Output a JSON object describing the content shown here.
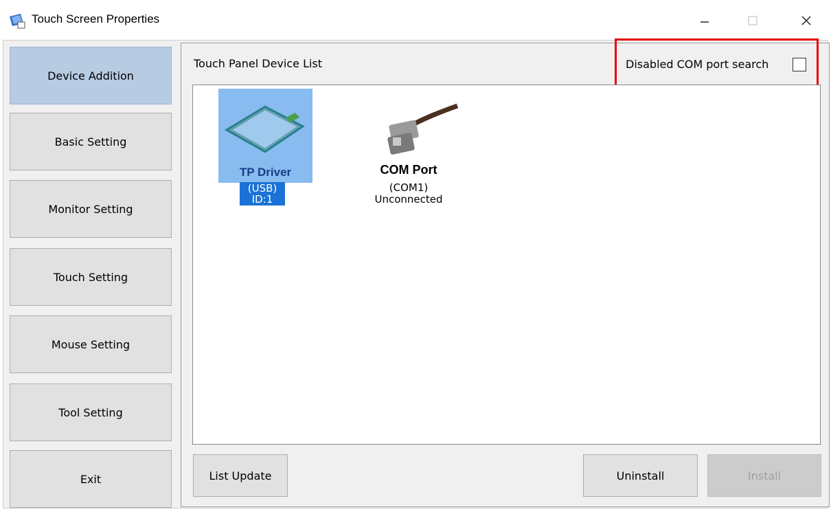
{
  "window": {
    "title": "Touch Screen Properties",
    "controls": {
      "minimize": "—",
      "maximize": "☐",
      "close": "✕"
    }
  },
  "sidebar": {
    "items": [
      {
        "label": "Device Addition",
        "active": true
      },
      {
        "label": "Basic Setting",
        "active": false
      },
      {
        "label": "Monitor Setting",
        "active": false
      },
      {
        "label": "Touch Setting",
        "active": false
      },
      {
        "label": "Mouse Setting",
        "active": false
      },
      {
        "label": "Tool Setting",
        "active": false
      },
      {
        "label": "Exit",
        "active": false
      }
    ]
  },
  "panel": {
    "title": "Touch Panel Device List",
    "com_search_label": "Disabled COM port search",
    "com_search_checked": false,
    "highlight_color": "#e50000"
  },
  "devices": [
    {
      "name": "TP Driver",
      "line1": "(USB)",
      "line2": "ID:1",
      "selected": true,
      "icon": "touch-panel-icon"
    },
    {
      "name": "COM Port",
      "line1": "(COM1)",
      "line2": "Unconnected",
      "selected": false,
      "icon": "serial-cable-icon"
    }
  ],
  "buttons": {
    "list_update": "List Update",
    "uninstall": "Uninstall",
    "install": "Install",
    "install_disabled": true
  },
  "colors": {
    "active_sidebar": "#b7cbe3",
    "selection": "#1a72d6",
    "selection_bg": "#88bbef"
  }
}
